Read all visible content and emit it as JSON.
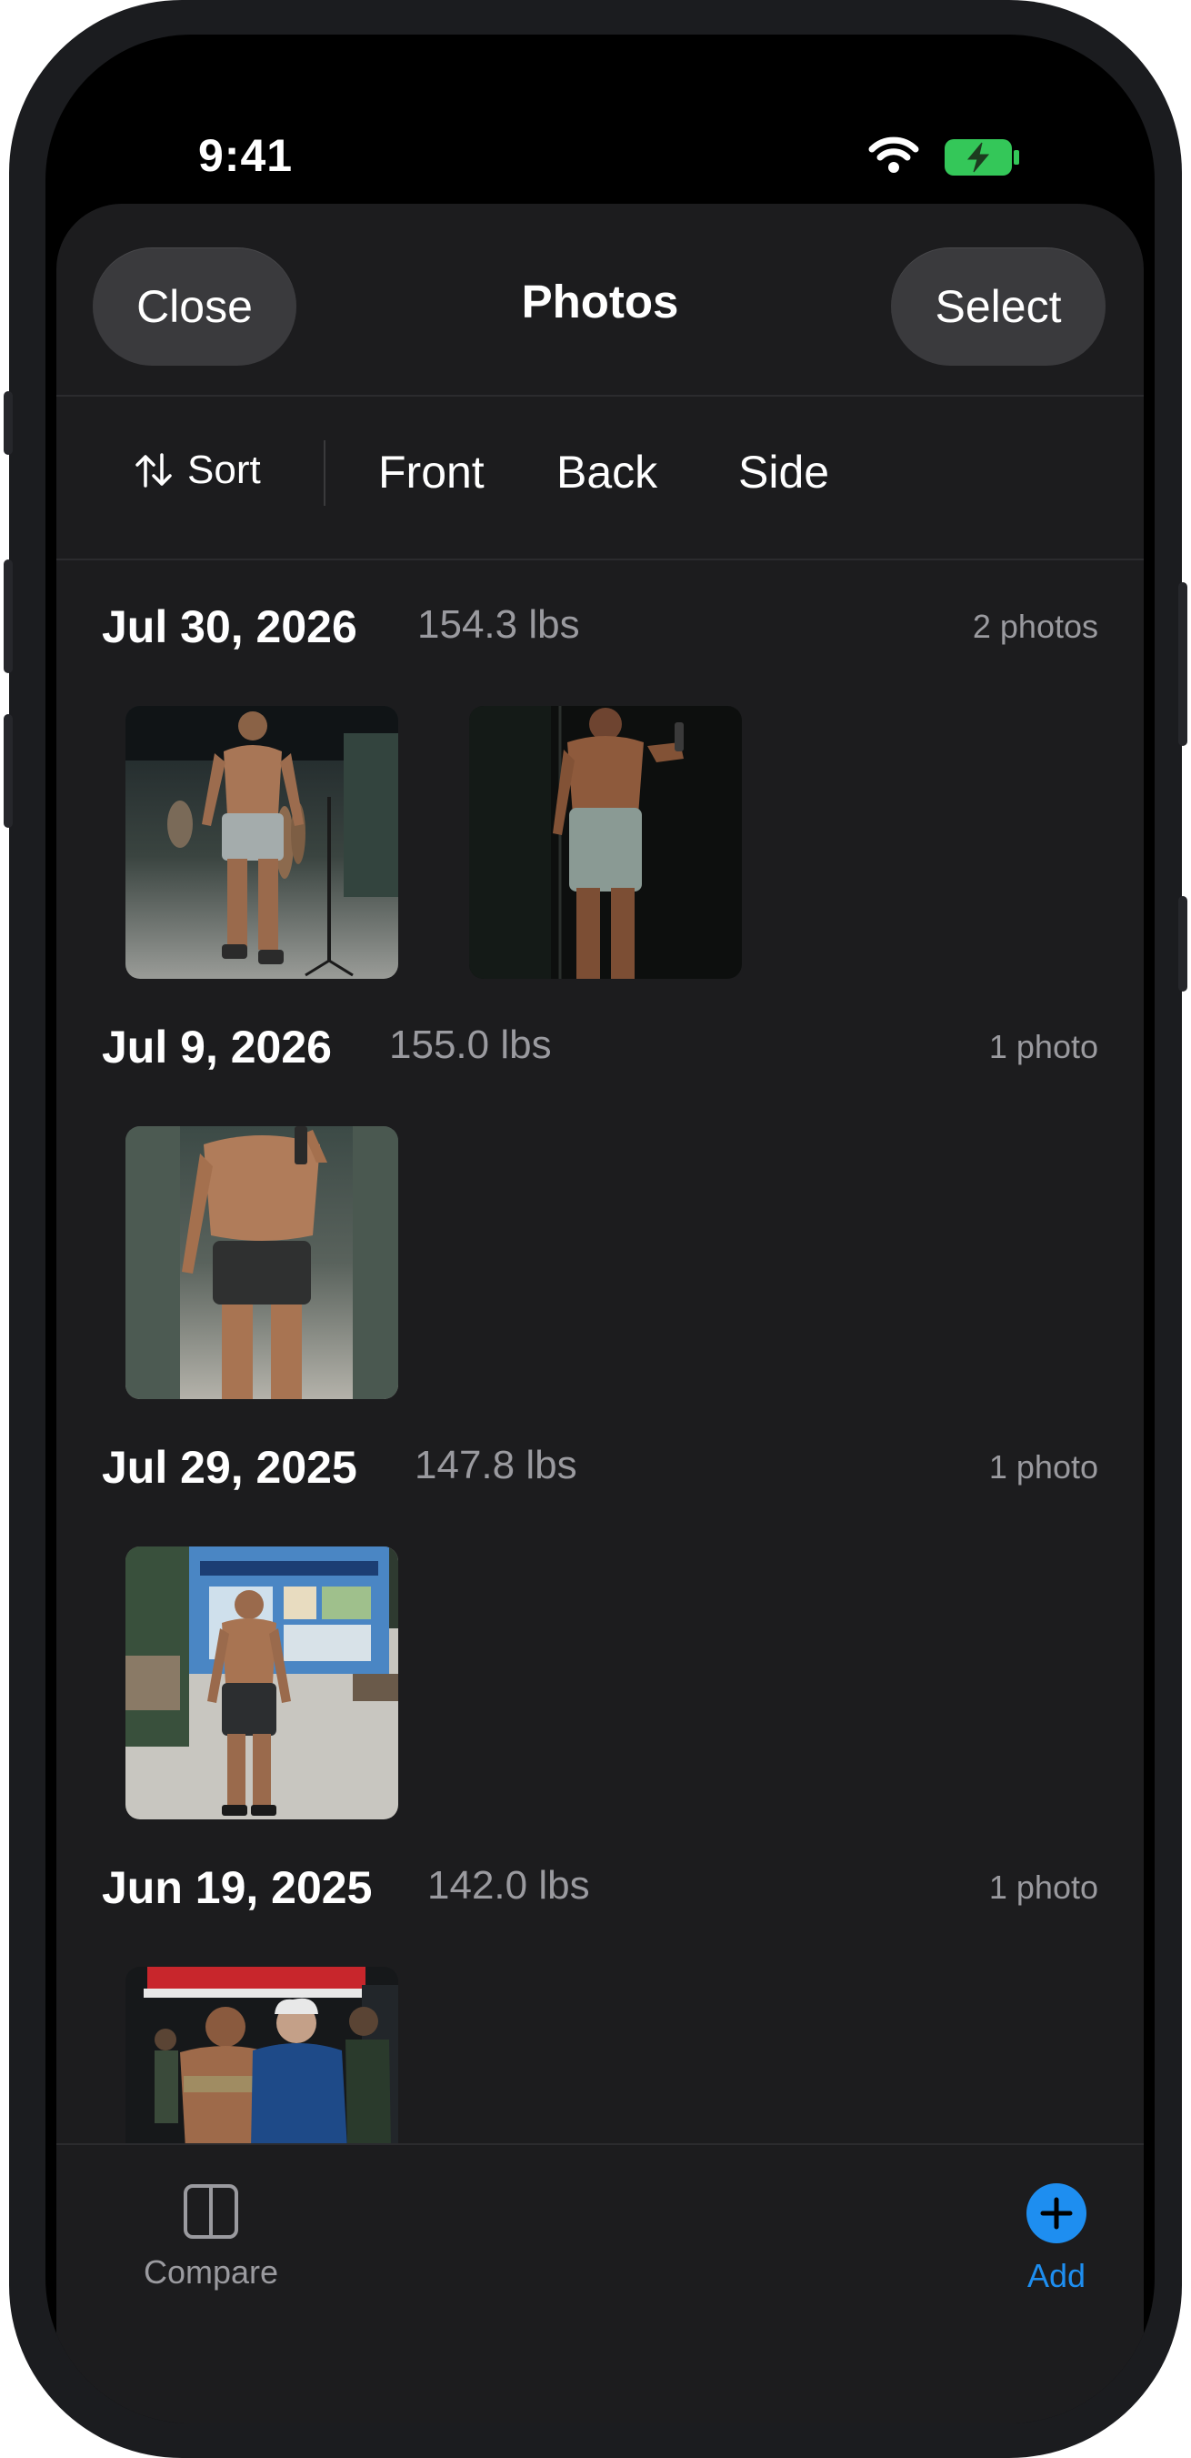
{
  "status_bar": {
    "time": "9:41"
  },
  "nav": {
    "close_label": "Close",
    "title": "Photos",
    "select_label": "Select"
  },
  "filters": {
    "sort_label": "Sort",
    "options": [
      "Front",
      "Back",
      "Side"
    ]
  },
  "groups": [
    {
      "date": "Jul 30, 2026",
      "weight": "154.3 lbs",
      "count": "2 photos"
    },
    {
      "date": "Jul 9, 2026",
      "weight": "155.0 lbs",
      "count": "1 photo"
    },
    {
      "date": "Jul 29, 2025",
      "weight": "147.8 lbs",
      "count": "1 photo"
    },
    {
      "date": "Jun 19, 2025",
      "weight": "142.0 lbs",
      "count": "1 photo"
    }
  ],
  "tabbar": {
    "compare_label": "Compare",
    "add_label": "Add"
  },
  "colors": {
    "accent": "#1e8ef0",
    "background": "#1c1c1e",
    "secondary_text": "#9a9a9f",
    "battery": "#34c759"
  }
}
